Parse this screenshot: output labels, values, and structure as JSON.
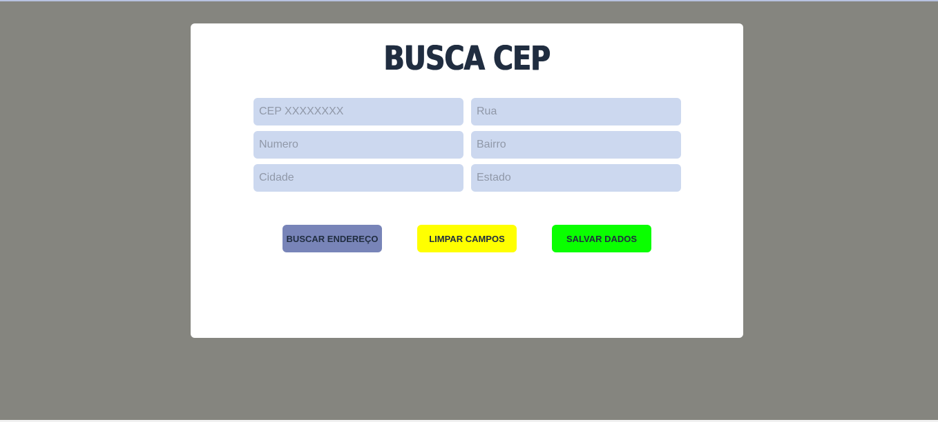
{
  "app": {
    "title": "BUSCA CEP"
  },
  "form": {
    "fields": [
      {
        "name": "cep",
        "placeholder": "CEP XXXXXXXX",
        "value": ""
      },
      {
        "name": "rua",
        "placeholder": "Rua",
        "value": ""
      },
      {
        "name": "numero",
        "placeholder": "Numero",
        "value": ""
      },
      {
        "name": "bairro",
        "placeholder": "Bairro",
        "value": ""
      },
      {
        "name": "cidade",
        "placeholder": "Cidade",
        "value": ""
      },
      {
        "name": "estado",
        "placeholder": "Estado",
        "value": ""
      }
    ]
  },
  "actions": {
    "buscar": {
      "label": "BUSCAR ENDEREÇO",
      "color": "#7884b8"
    },
    "limpar": {
      "label": "LIMPAR CAMPOS",
      "color": "#ffff00"
    },
    "salvar": {
      "label": "SALVAR DADOS",
      "color": "#0aff00"
    }
  },
  "theme": {
    "page_background": "#85857f",
    "card_background": "#ffffff",
    "title_color": "#202d40",
    "field_background": "#ccd8ef"
  }
}
